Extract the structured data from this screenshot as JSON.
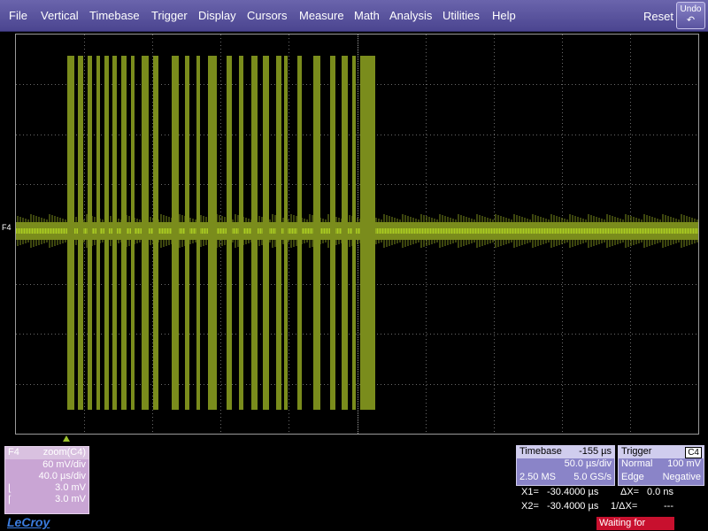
{
  "menu": {
    "items": [
      "File",
      "Vertical",
      "Timebase",
      "Trigger",
      "Display",
      "Cursors",
      "Measure",
      "Math",
      "Analysis",
      "Utilities",
      "Help"
    ],
    "reset_label": "Reset",
    "undo_label": "Undo",
    "undo_icon": "undo-arrow-icon"
  },
  "trace": {
    "marker_label": "F4",
    "name": "F4",
    "source": "zoom(C4)",
    "vdiv": "60 mV/div",
    "tdiv": "40.0 µs/div",
    "param1_value": "3.0 mV",
    "param2_value": "3.0 mV",
    "color": "#7a8c1c"
  },
  "timebase": {
    "label": "Timebase",
    "delay": "-155 µs",
    "tdiv": "50.0 µs/div",
    "samples": "2.50 MS",
    "rate": "5.0 GS/s"
  },
  "trigger": {
    "label": "Trigger",
    "channel": "C4",
    "mode": "Normal",
    "level": "100 mV",
    "type": "Edge",
    "slope": "Negative"
  },
  "cursors": {
    "x1_label": "X1=",
    "x1_value": "-30.4000 µs",
    "dx_label": "ΔX=",
    "dx_value": "0.0 ns",
    "x2_label": "X2=",
    "x2_value": "-30.4000 µs",
    "inv_dx_label": "1/ΔX=",
    "inv_dx_value": "---"
  },
  "status": "Waiting for Trigger",
  "brand": "LeCroy"
}
